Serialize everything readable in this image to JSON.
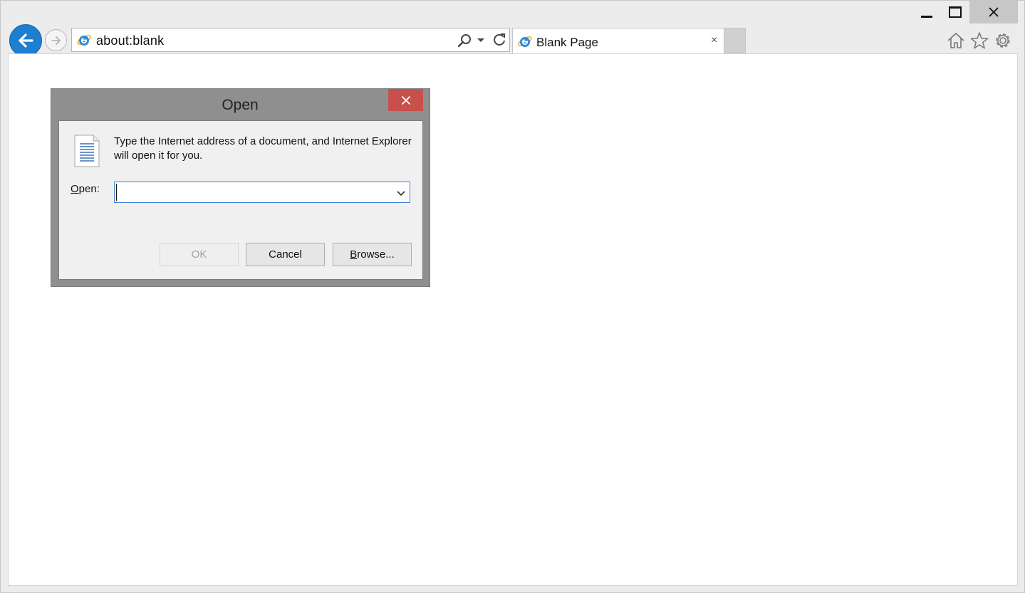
{
  "browser": {
    "address": "about:blank",
    "tab_title": "Blank Page",
    "tab_close_glyph": "×"
  },
  "dialog": {
    "title": "Open",
    "message": "Type the Internet address of a document, and Internet Explorer will open it for you.",
    "open_label_access": "O",
    "open_label_rest": "pen:",
    "open_value": "",
    "ok_label": "OK",
    "cancel_label": "Cancel",
    "browse_access": "B",
    "browse_rest": "rowse..."
  },
  "colors": {
    "back_button": "#1e7fd1",
    "dialog_close": "#c8504c",
    "input_focus_border": "#3c84d6"
  },
  "icons": [
    "ie-logo-icon",
    "back-arrow-icon",
    "forward-arrow-icon",
    "search-icon",
    "refresh-icon",
    "home-icon",
    "star-icon",
    "gear-icon",
    "close-icon",
    "document-icon",
    "chevron-down-icon"
  ]
}
